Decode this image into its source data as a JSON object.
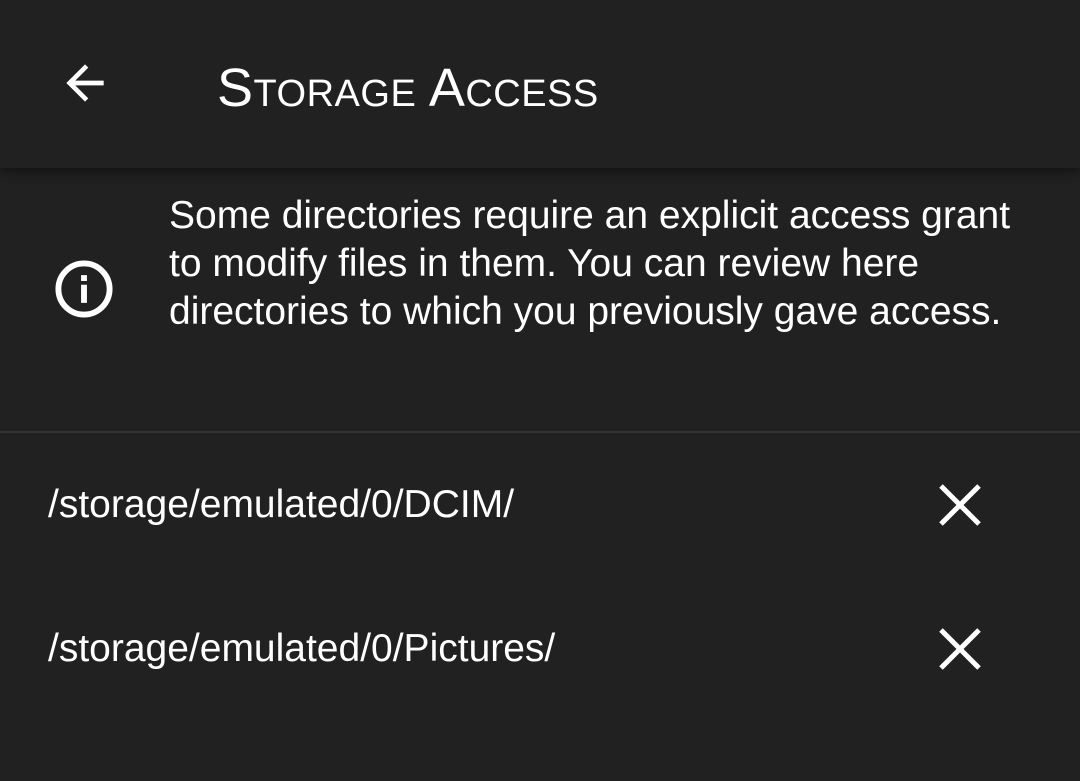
{
  "app_bar": {
    "title": "Storage Access",
    "back_icon": "arrow-back-icon"
  },
  "info": {
    "icon": "info-icon",
    "text": "Some directories require an explicit access grant to modify files in them. You can review here directories to which you previously gave access."
  },
  "directories": [
    {
      "path": "/storage/emulated/0/DCIM/",
      "remove_icon": "close-icon"
    },
    {
      "path": "/storage/emulated/0/Pictures/",
      "remove_icon": "close-icon"
    }
  ],
  "colors": {
    "background": "#212121",
    "text": "#ffffff",
    "divider": "#343434"
  }
}
